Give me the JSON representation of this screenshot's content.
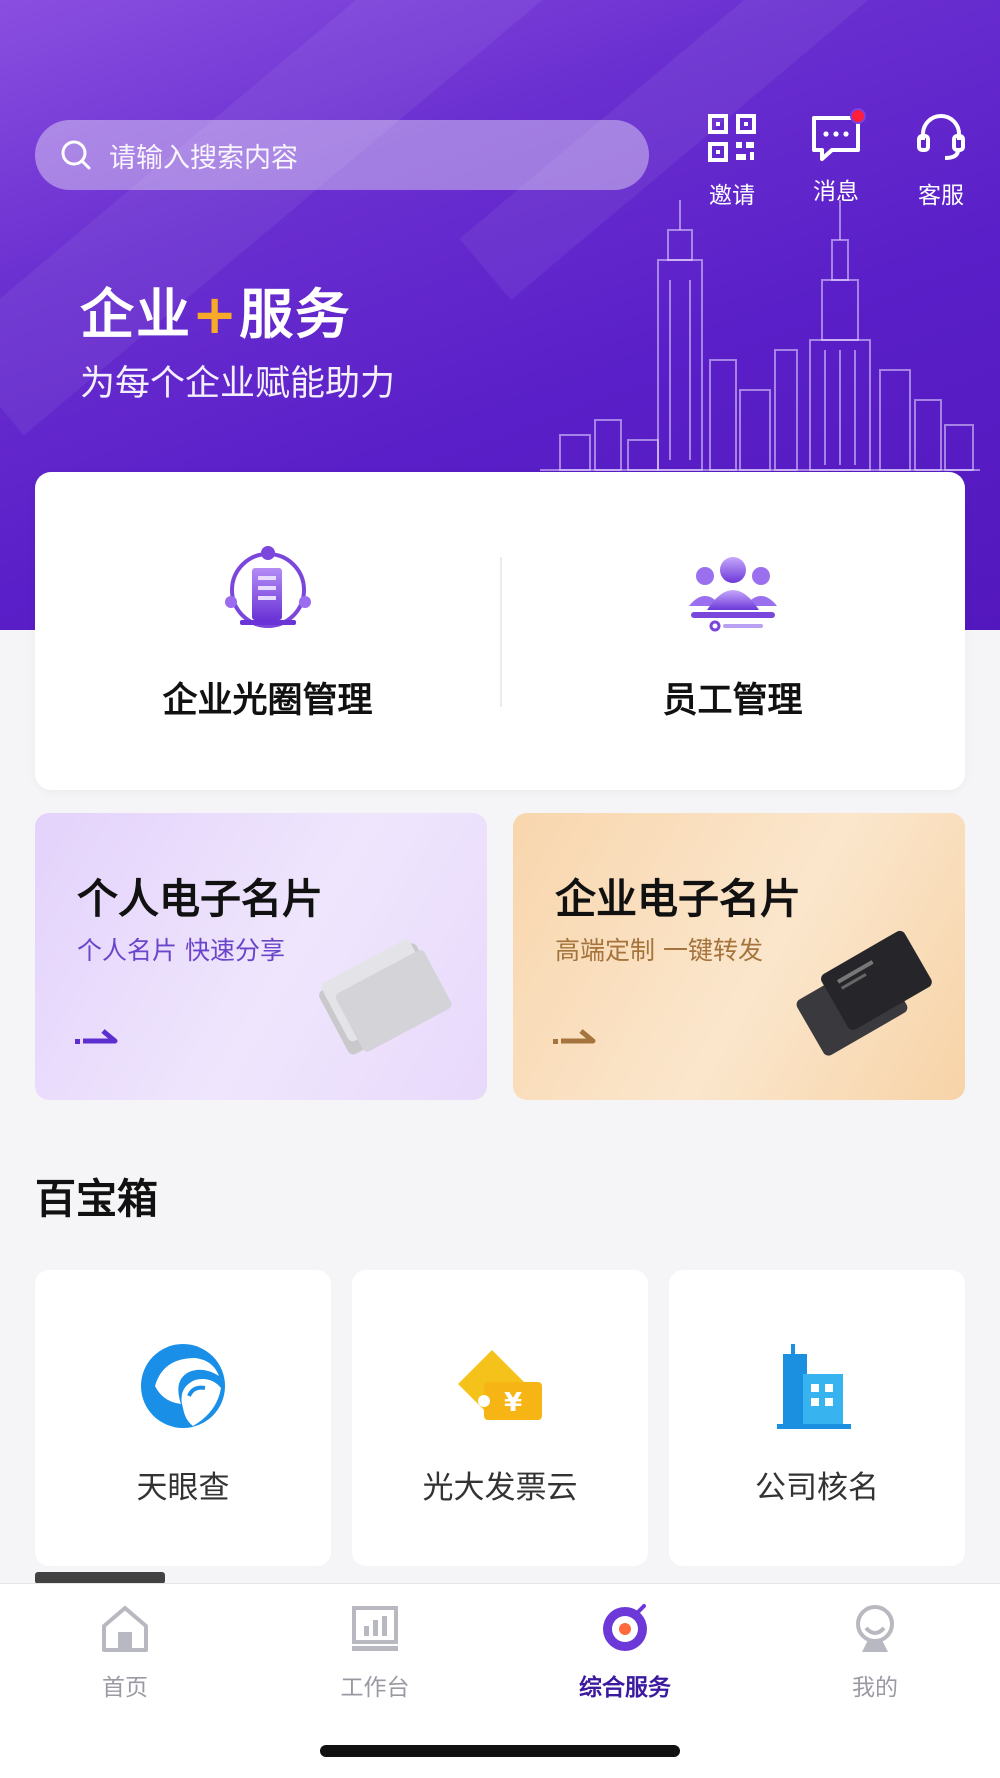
{
  "header": {
    "search_placeholder": "请输入搜索内容",
    "actions": [
      {
        "label": "邀请",
        "icon": "qr-code-icon"
      },
      {
        "label": "消息",
        "icon": "message-icon",
        "badge": true
      },
      {
        "label": "客服",
        "icon": "headset-icon"
      }
    ]
  },
  "banner": {
    "title_left": "企业",
    "title_plus": "+",
    "title_right": "服务",
    "subtitle": "为每个企业赋能助力"
  },
  "management": [
    {
      "label": "企业光圈管理",
      "icon": "enterprise-circle-icon"
    },
    {
      "label": "员工管理",
      "icon": "staff-management-icon"
    }
  ],
  "business_cards": [
    {
      "title": "个人电子名片",
      "subtitle": "个人名片 快速分享",
      "icon": "silver-card-holder-icon"
    },
    {
      "title": "企业电子名片",
      "subtitle": "高端定制 一键转发",
      "icon": "black-business-cards-icon"
    }
  ],
  "toolbox": {
    "title": "百宝箱",
    "items": [
      {
        "label": "天眼查",
        "icon": "tianyancha-logo-icon"
      },
      {
        "label": "光大发票云",
        "icon": "invoice-cloud-icon"
      },
      {
        "label": "公司核名",
        "icon": "company-building-icon"
      }
    ]
  },
  "tabbar": {
    "tabs": [
      {
        "label": "首页",
        "icon": "home-icon",
        "active": false
      },
      {
        "label": "工作台",
        "icon": "workbench-icon",
        "active": false
      },
      {
        "label": "综合服务",
        "icon": "services-icon",
        "active": true
      },
      {
        "label": "我的",
        "icon": "profile-icon",
        "active": false
      }
    ]
  },
  "colors": {
    "brand_purple": "#5a1fc8",
    "accent_orange": "#f7a928",
    "badge_red": "#ff1f3a",
    "active_tab": "#3b1aa0"
  }
}
